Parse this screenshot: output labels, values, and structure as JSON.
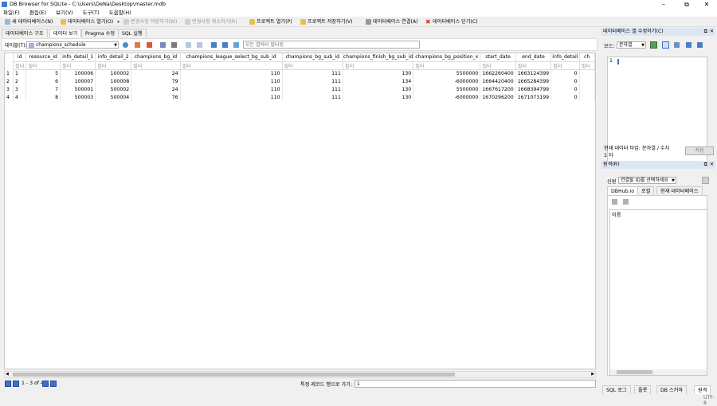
{
  "window": {
    "title": "DB Browser for SQLite - C:\\Users\\DeNa\\Desktop\\master.mdb"
  },
  "menu": [
    "파일(F)",
    "편집(E)",
    "보기(V)",
    "도구(T)",
    "도움말(H)"
  ],
  "toolbar": {
    "new_db": "새 데이터베이스(N)",
    "open_db": "데이터베이스 열기(O)",
    "write_changes": "변경사항 저장하기(W)",
    "revert_changes": "변경사항 취소하기(R)",
    "open_project": "프로젝트 열기(P)",
    "save_project": "프로젝트 저장하기(V)",
    "attach_db": "데이터베이스 연결(A)",
    "close_db": "데이터베이스 닫기(C)"
  },
  "main_tabs": [
    "데이터베이스 구조",
    "데이터 보기",
    "Pragma 수정",
    "SQL 실행"
  ],
  "browse": {
    "table_label": "테이블(T):",
    "table_name": "champions_schedule",
    "filter_placeholder": "모든 열에서 필터링"
  },
  "columns": [
    "id",
    "resource_id",
    "info_detail_1",
    "info_detail_2",
    "champions_bg_id",
    "champions_league_select_bg_sub_id",
    "champions_bg_sub_id",
    "champions_finish_bg_sub_id",
    "champions_bg_position_x",
    "start_date",
    "end_date",
    "info_detail",
    "ch"
  ],
  "filter_text": "필터",
  "rows": [
    {
      "n": "1",
      "cells": [
        "1",
        "5",
        "100006",
        "100002",
        "24",
        "110",
        "111",
        "130",
        "5500000",
        "1662260400",
        "1663124399",
        "0"
      ]
    },
    {
      "n": "2",
      "cells": [
        "2",
        "6",
        "100007",
        "100008",
        "79",
        "110",
        "111",
        "134",
        "-6000000",
        "1664420400",
        "1665284399",
        "0"
      ]
    },
    {
      "n": "3",
      "cells": [
        "3",
        "7",
        "500001",
        "500002",
        "24",
        "110",
        "111",
        "130",
        "5500000",
        "1667617200",
        "1668394799",
        "0"
      ]
    },
    {
      "n": "4",
      "cells": [
        "4",
        "8",
        "500003",
        "500004",
        "76",
        "110",
        "111",
        "130",
        "-6000000",
        "1670296200",
        "1671073199",
        "0"
      ]
    }
  ],
  "pager": {
    "range": "1 - 3 of 4",
    "goto_label": "특정 레코드 행으로 가기:",
    "goto_value": "1"
  },
  "edit_cell": {
    "title": "데이터베이스 셀 수정하기(C)",
    "mode_label": "모드:",
    "mode_value": "문자열",
    "editor_line": "1",
    "type_info": "현재 데이터 타입: 문자열 / 수치",
    "size_info": "1 자",
    "apply": "적용"
  },
  "remote": {
    "title": "원격(R)",
    "identity_label": "신원",
    "identity_value": "연결할 ID를 선택하세요",
    "tabs": [
      "DBHub.io",
      "로컬",
      "현재 데이터베이스"
    ],
    "column_header": "이름"
  },
  "bottom_tabs": [
    "SQL 로그",
    "플롯",
    "DB 스키마",
    "원격"
  ],
  "status": {
    "encoding": "UTF-8"
  },
  "colors": {
    "accent": "#3c6fd0",
    "selection_bg": "#cce4f7",
    "header_bg": "#dde6f3",
    "close_red": "#d83b2b"
  }
}
